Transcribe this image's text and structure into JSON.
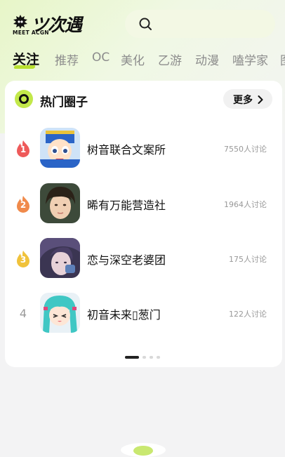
{
  "header": {
    "logo_title": "ツ次遇",
    "logo_subtitle": "MEET ACGN",
    "search_icon": "search-icon"
  },
  "tabs": [
    {
      "label": "关注",
      "active": true
    },
    {
      "label": "推荐",
      "active": false
    },
    {
      "label": "OC",
      "active": false
    },
    {
      "label": "美化",
      "active": false
    },
    {
      "label": "乙游",
      "active": false
    },
    {
      "label": "动漫",
      "active": false
    },
    {
      "label": "嗑学家",
      "active": false
    },
    {
      "label": "图",
      "active": false
    }
  ],
  "hot_circles": {
    "title": "热门圈子",
    "more_label": "更多",
    "items": [
      {
        "rank": "1",
        "name": "树音联合文案所",
        "count": "7550人讨论"
      },
      {
        "rank": "2",
        "name": "晞有万能营造社",
        "count": "1964人讨论"
      },
      {
        "rank": "3",
        "name": "恋与深空老婆团",
        "count": "175人讨论"
      },
      {
        "rank": "4",
        "name": "初音未来▯葱门",
        "count": "122人讨论"
      }
    ]
  },
  "colors": {
    "accent": "#b8e02e",
    "rank1": "#ee5a5a",
    "rank2": "#f08a4b",
    "rank3": "#f0c23b"
  }
}
